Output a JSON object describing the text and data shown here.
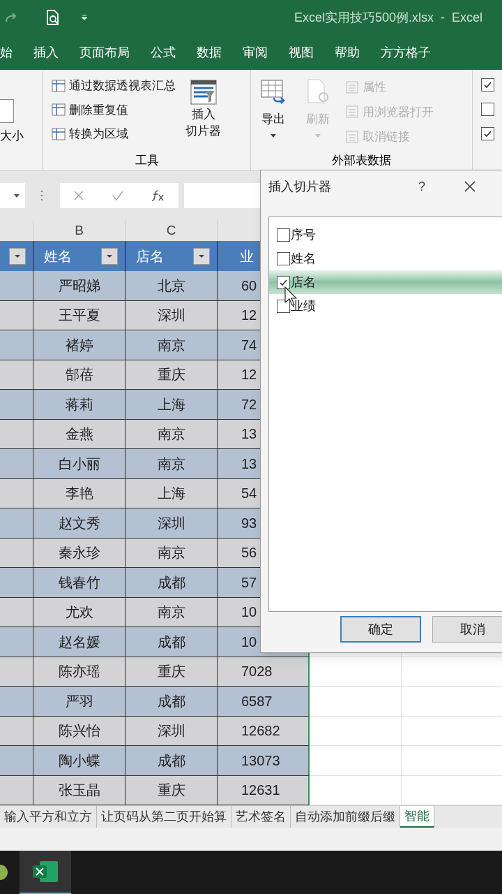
{
  "title_bar": {
    "title": "Excel实用技巧500例.xlsx  -  Excel"
  },
  "menu_tabs": [
    "始",
    "插入",
    "页面布局",
    "公式",
    "数据",
    "审阅",
    "视图",
    "帮助",
    "方方格子"
  ],
  "ribbon": {
    "size_label": "大小",
    "tools_group": {
      "label": "工具",
      "items": [
        {
          "label": "通过数据透视表汇总"
        },
        {
          "label": "删除重复值"
        },
        {
          "label": "转换为区域"
        }
      ],
      "slicer_button": [
        "插入",
        "切片器"
      ]
    },
    "external_group": {
      "label": "外部表数据",
      "big_buttons": [
        {
          "label": "导出",
          "disabled": false
        },
        {
          "label": "刷新",
          "disabled": true
        }
      ],
      "items": [
        {
          "label": "属性",
          "disabled": true
        },
        {
          "label": "用浏览器打开",
          "disabled": true
        },
        {
          "label": "取消链接",
          "disabled": true
        }
      ]
    },
    "style_options": [
      {
        "checked": true
      },
      {
        "checked": false
      },
      {
        "checked": true
      }
    ]
  },
  "column_letters": [
    "B",
    "C"
  ],
  "table": {
    "headers": [
      "姓名",
      "店名",
      "业"
    ],
    "rows": [
      {
        "name": "严昭娣",
        "store": "北京",
        "column_4": "60"
      },
      {
        "name": "王平夏",
        "store": "深圳",
        "column_4": "12"
      },
      {
        "name": "褚婷",
        "store": "南京",
        "column_4": "74"
      },
      {
        "name": "郜蓓",
        "store": "重庆",
        "column_4": "12"
      },
      {
        "name": "蒋莉",
        "store": "上海",
        "column_4": "72"
      },
      {
        "name": "金燕",
        "store": "南京",
        "column_4": "13"
      },
      {
        "name": "白小丽",
        "store": "南京",
        "column_4": "13"
      },
      {
        "name": "李艳",
        "store": "上海",
        "column_4": "54"
      },
      {
        "name": "赵文秀",
        "store": "深圳",
        "column_4": "93"
      },
      {
        "name": "秦永珍",
        "store": "南京",
        "column_4": "56"
      },
      {
        "name": "钱春竹",
        "store": "成都",
        "column_4": "57"
      },
      {
        "name": "尤欢",
        "store": "南京",
        "column_4": "10"
      },
      {
        "name": "赵名媛",
        "store": "成都",
        "column_4": "10"
      },
      {
        "name": "陈亦瑶",
        "store": "重庆",
        "column_4": "7028"
      },
      {
        "name": "严羽",
        "store": "成都",
        "column_4": "6587"
      },
      {
        "name": "陈兴怡",
        "store": "深圳",
        "column_4": "12682"
      },
      {
        "name": "陶小蝶",
        "store": "成都",
        "column_4": "13073"
      },
      {
        "name": "张玉晶",
        "store": "重庆",
        "column_4": "12631"
      }
    ]
  },
  "dialog": {
    "title": "插入切片器",
    "help": "?",
    "fields": [
      {
        "label": "序号",
        "checked": false,
        "selected": false
      },
      {
        "label": "姓名",
        "checked": false,
        "selected": false
      },
      {
        "label": "店名",
        "checked": true,
        "selected": true
      },
      {
        "label": "业绩",
        "checked": false,
        "selected": false
      }
    ],
    "buttons": [
      {
        "label": "确定",
        "kind": "default"
      },
      {
        "label": "取消",
        "kind": "normal"
      }
    ]
  },
  "sheet_tabs": [
    {
      "label": "输入平方和立方",
      "selected": false
    },
    {
      "label": "让页码从第二页开始算",
      "selected": false
    },
    {
      "label": "艺术签名",
      "selected": false
    },
    {
      "label": "自动添加前缀后缀",
      "selected": false
    },
    {
      "label": "智能",
      "selected": true
    }
  ]
}
